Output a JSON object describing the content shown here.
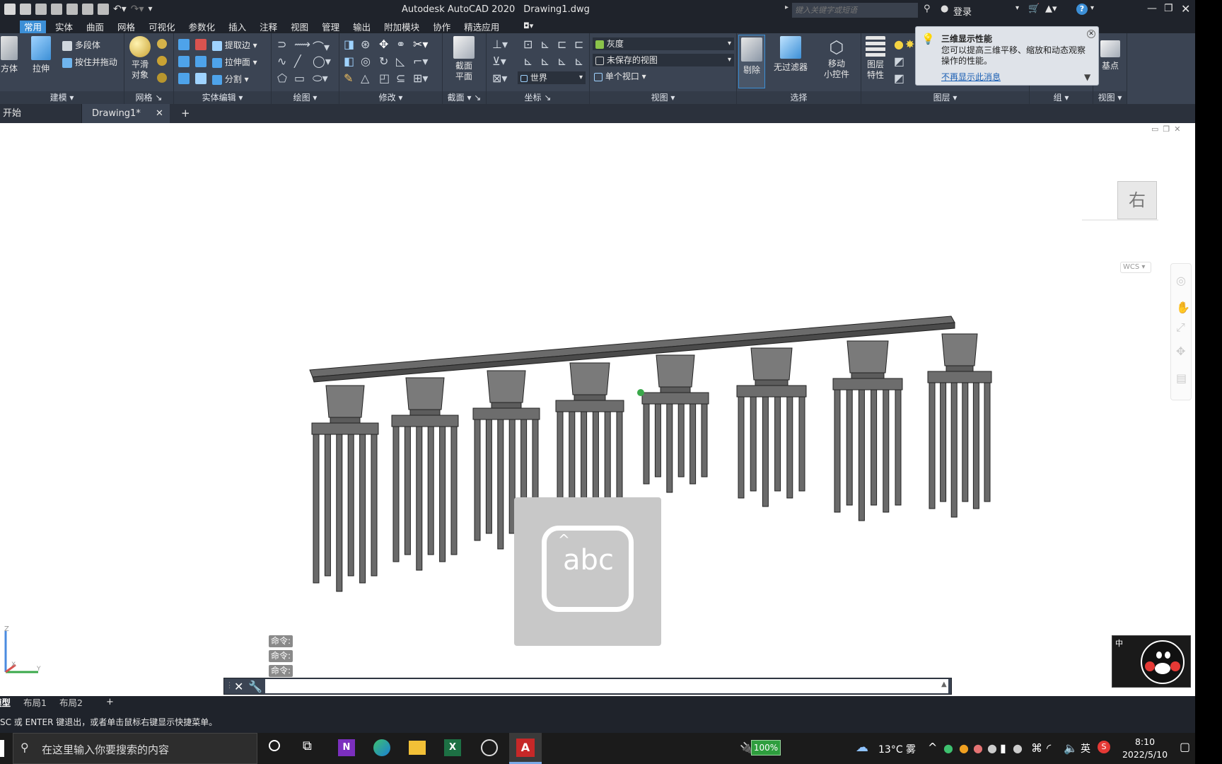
{
  "app": {
    "window_title": "Autodesk AutoCAD 2020",
    "document": "Drawing1.dwg",
    "search_placeholder": "键入关键字或短语",
    "login_label": "登录"
  },
  "menu_tabs": [
    "常用",
    "实体",
    "曲面",
    "网格",
    "可视化",
    "参数化",
    "插入",
    "注释",
    "视图",
    "管理",
    "输出",
    "附加模块",
    "协作",
    "精选应用"
  ],
  "ribbon": {
    "modeling": {
      "box": "方体",
      "extrude": "拉伸",
      "polysolid": "多段体",
      "presspull": "按住并拖动",
      "footer": "建模"
    },
    "mesh": {
      "smooth": "平滑\n对象",
      "footer": "网格"
    },
    "solid_edit": {
      "extract_edges": "提取边",
      "extrude_faces": "拉伸面",
      "separate": "分割",
      "footer": "实体编辑"
    },
    "draw": {
      "footer": "绘图"
    },
    "modify": {
      "footer": "修改"
    },
    "section": {
      "plane": "截面\n平面",
      "footer": "截面"
    },
    "coordinates": {
      "world": "世界",
      "footer": "坐标"
    },
    "view": {
      "visual_style": "灰度",
      "named_view": "未保存的视图",
      "viewport": "单个视口",
      "footer": "视图"
    },
    "selection": {
      "cull": "剔除",
      "no_filter": "无过滤器",
      "gizmo": "移动\n小控件",
      "footer": "选择"
    },
    "layers": {
      "props": "图层\n特性",
      "footer": "图层"
    },
    "groups": {
      "footer": "组"
    },
    "view2": {
      "base": "基点",
      "footer": "视图"
    }
  },
  "tooltip": {
    "title": "三维显示性能",
    "body": "您可以提高三维平移、缩放和动态观察操作的性能。",
    "link": "不再显示此消息"
  },
  "doc_tabs": {
    "start": "开始",
    "drawing": "Drawing1*"
  },
  "viewcube": {
    "face": "右",
    "wcs": "WCS"
  },
  "command": {
    "history": [
      "命令:",
      "命令:",
      "命令:"
    ]
  },
  "ime_overlay": {
    "label": "abc"
  },
  "layout_tabs": [
    "模型",
    "布局1",
    "布局2"
  ],
  "status_message": "SC 或 ENTER 键退出，或者单击鼠标右键显示快捷菜单。",
  "taskbar": {
    "search_placeholder": "在这里输入你要搜索的内容",
    "battery": "100%",
    "weather": "13°C 雾",
    "ime": "英",
    "time": "8:10",
    "date": "2022/5/10"
  },
  "ime_widget": {
    "mode": "中"
  },
  "colors": {
    "accent": "#3c8fd6",
    "ribbon": "#3b4453",
    "title": "#1f232b"
  }
}
